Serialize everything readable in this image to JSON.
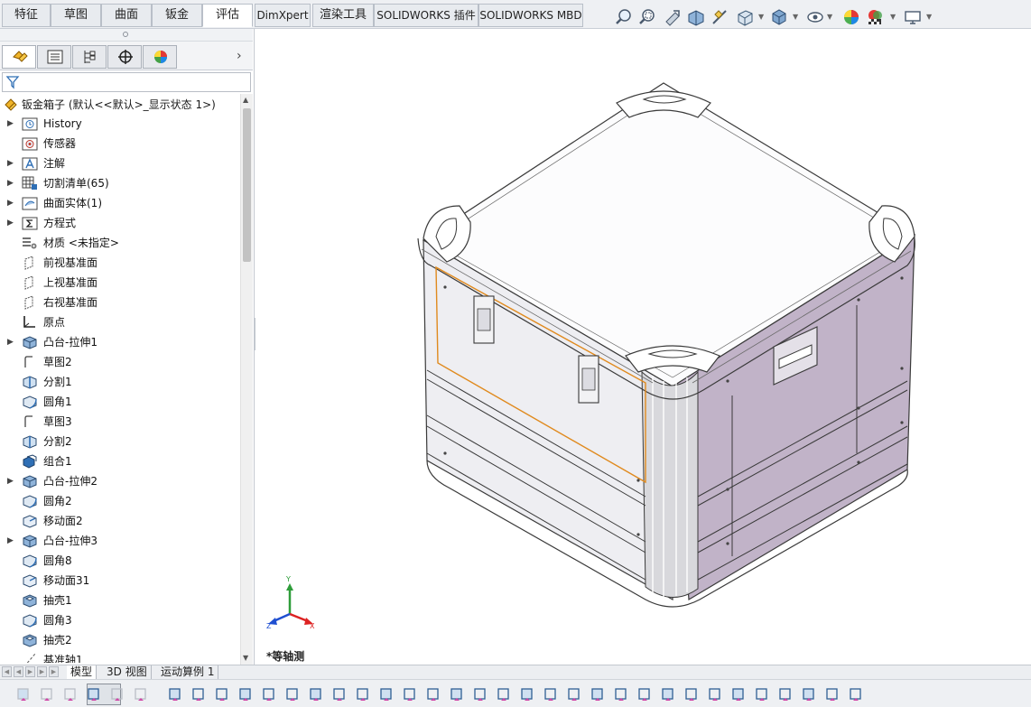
{
  "command_tabs": [
    {
      "label": "特征",
      "active": false
    },
    {
      "label": "草图",
      "active": false
    },
    {
      "label": "曲面",
      "active": false
    },
    {
      "label": "钣金",
      "active": false
    },
    {
      "label": "评估",
      "active": true
    },
    {
      "label": "DimXpert",
      "active": false
    },
    {
      "label": "渲染工具",
      "active": false
    },
    {
      "label": "SOLIDWORKS 插件",
      "active": false
    },
    {
      "label": "SOLIDWORKS MBD",
      "active": false
    }
  ],
  "manager_tabs": [
    {
      "icon": "feature-manager-icon",
      "active": true
    },
    {
      "icon": "property-manager-icon",
      "active": false
    },
    {
      "icon": "configuration-manager-icon",
      "active": false
    },
    {
      "icon": "dimxpert-manager-icon",
      "active": false
    },
    {
      "icon": "display-manager-icon",
      "active": false
    }
  ],
  "tree": {
    "root_label": "钣金箱子 (默认<<默认>_显示状态 1>)",
    "items": [
      {
        "label": "History",
        "icon": "history-icon",
        "expandable": true
      },
      {
        "label": "传感器",
        "icon": "sensor-icon",
        "expandable": false
      },
      {
        "label": "注解",
        "icon": "annotation-icon",
        "expandable": true
      },
      {
        "label": "切割清单(65)",
        "icon": "cut-list-icon",
        "expandable": true
      },
      {
        "label": "曲面实体(1)",
        "icon": "surface-body-icon",
        "expandable": true
      },
      {
        "label": "方程式",
        "icon": "equation-icon",
        "expandable": true
      },
      {
        "label": "材质 <未指定>",
        "icon": "material-icon",
        "expandable": false
      },
      {
        "label": "前视基准面",
        "icon": "plane-icon",
        "expandable": false
      },
      {
        "label": "上视基准面",
        "icon": "plane-icon",
        "expandable": false
      },
      {
        "label": "右视基准面",
        "icon": "plane-icon",
        "expandable": false
      },
      {
        "label": "原点",
        "icon": "origin-icon",
        "expandable": false
      },
      {
        "label": "凸台-拉伸1",
        "icon": "extrude-icon",
        "expandable": true
      },
      {
        "label": "草图2",
        "icon": "sketch-icon",
        "expandable": false
      },
      {
        "label": "分割1",
        "icon": "split-icon",
        "expandable": false
      },
      {
        "label": "圆角1",
        "icon": "fillet-icon",
        "expandable": false
      },
      {
        "label": "草图3",
        "icon": "sketch-icon",
        "expandable": false
      },
      {
        "label": "分割2",
        "icon": "split-icon",
        "expandable": false
      },
      {
        "label": "组合1",
        "icon": "combine-icon",
        "expandable": false
      },
      {
        "label": "凸台-拉伸2",
        "icon": "extrude-icon",
        "expandable": true
      },
      {
        "label": "圆角2",
        "icon": "fillet-icon",
        "expandable": false
      },
      {
        "label": "移动面2",
        "icon": "move-face-icon",
        "expandable": false
      },
      {
        "label": "凸台-拉伸3",
        "icon": "extrude-icon",
        "expandable": true
      },
      {
        "label": "圆角8",
        "icon": "fillet-icon",
        "expandable": false
      },
      {
        "label": "移动面31",
        "icon": "move-face-icon",
        "expandable": false
      },
      {
        "label": "抽壳1",
        "icon": "shell-icon",
        "expandable": false
      },
      {
        "label": "圆角3",
        "icon": "fillet-icon",
        "expandable": false
      },
      {
        "label": "抽壳2",
        "icon": "shell-icon",
        "expandable": false
      },
      {
        "label": "基准轴1",
        "icon": "axis-icon",
        "expandable": false
      }
    ]
  },
  "viewport": {
    "view_label": "*等轴测",
    "triad": {
      "x": "X",
      "y": "Y",
      "z": "Z"
    }
  },
  "bottom_tabs": [
    {
      "label": "模型",
      "active": true
    },
    {
      "label": "3D 视图",
      "active": false
    },
    {
      "label": "运动算例 1",
      "active": false
    }
  ],
  "colors": {
    "accent_blue": "#2f6fb5",
    "selection_orange": "#e08a1e",
    "box_side_right": "#bfb0c6",
    "box_side_left": "#ececef",
    "lid_top": "#fbfbfc"
  }
}
